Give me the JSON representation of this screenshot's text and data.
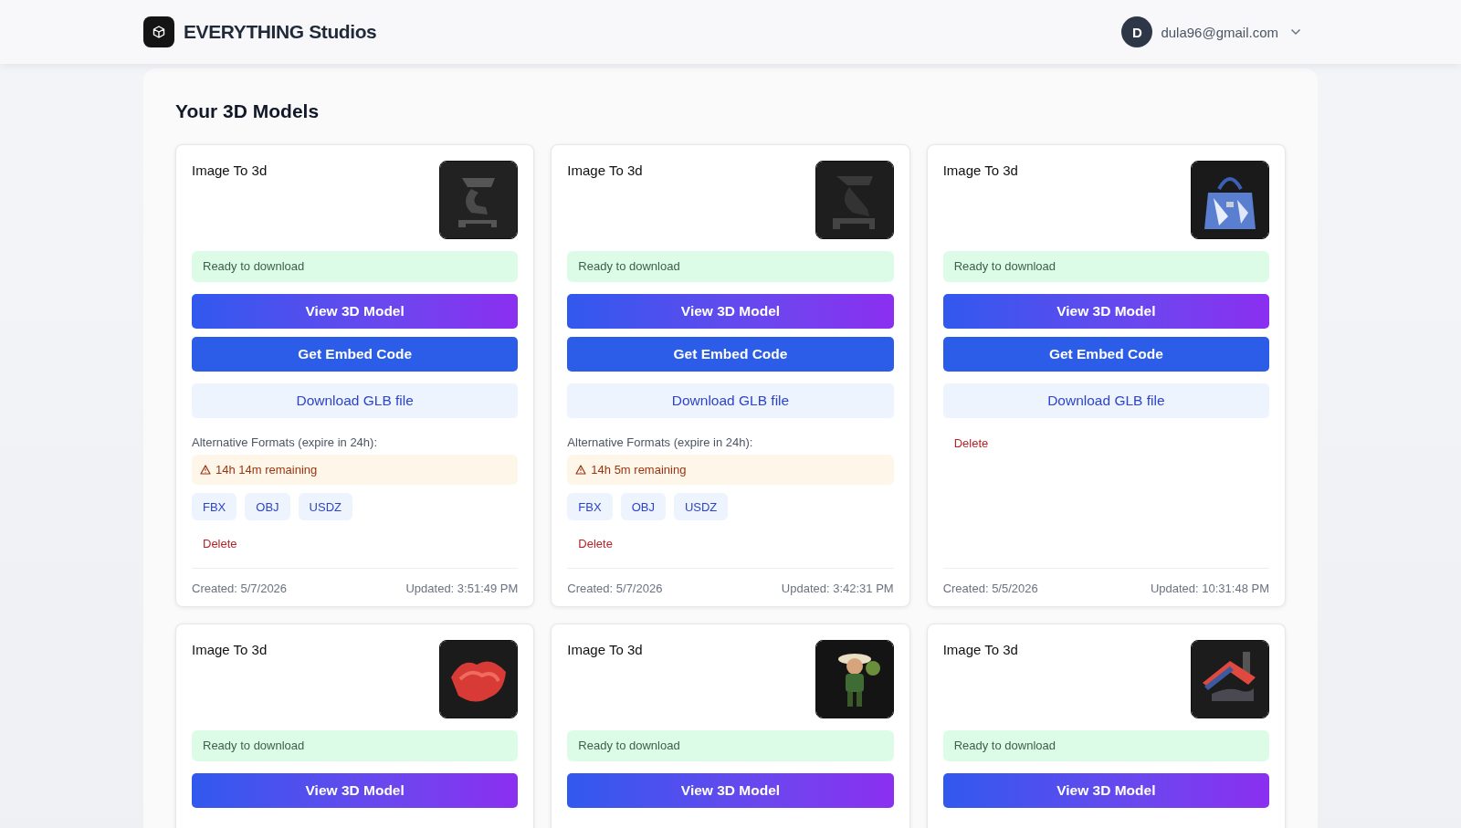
{
  "header": {
    "brand": "EVERYTHING Studios",
    "user": {
      "initial": "D",
      "email": "dula96@gmail.com"
    }
  },
  "page_title": "Your 3D Models",
  "models": [
    {
      "title": "Image To 3d",
      "status": "Ready to download",
      "view_button": "View 3D Model",
      "embed_button": "Get Embed Code",
      "download_button": "Download GLB file",
      "formats_label": "Alternative Formats (expire in 24h):",
      "remaining": "14h 14m remaining",
      "formats": [
        "FBX",
        "OBJ",
        "USDZ"
      ],
      "delete": "Delete",
      "created": "Created: 5/7/2026",
      "updated": "Updated: 3:51:49 PM"
    },
    {
      "title": "Image To 3d",
      "status": "Ready to download",
      "view_button": "View 3D Model",
      "embed_button": "Get Embed Code",
      "download_button": "Download GLB file",
      "formats_label": "Alternative Formats (expire in 24h):",
      "remaining": "14h 5m remaining",
      "formats": [
        "FBX",
        "OBJ",
        "USDZ"
      ],
      "delete": "Delete",
      "created": "Created: 5/7/2026",
      "updated": "Updated: 3:42:31 PM"
    },
    {
      "title": "Image To 3d",
      "status": "Ready to download",
      "view_button": "View 3D Model",
      "embed_button": "Get Embed Code",
      "download_button": "Download GLB file",
      "delete": "Delete",
      "created": "Created: 5/5/2026",
      "updated": "Updated: 10:31:48 PM"
    },
    {
      "title": "Image To 3d",
      "status": "Ready to download",
      "view_button": "View 3D Model"
    },
    {
      "title": "Image To 3d",
      "status": "Ready to download",
      "view_button": "View 3D Model"
    },
    {
      "title": "Image To 3d",
      "status": "Ready to download",
      "view_button": "View 3D Model"
    }
  ]
}
